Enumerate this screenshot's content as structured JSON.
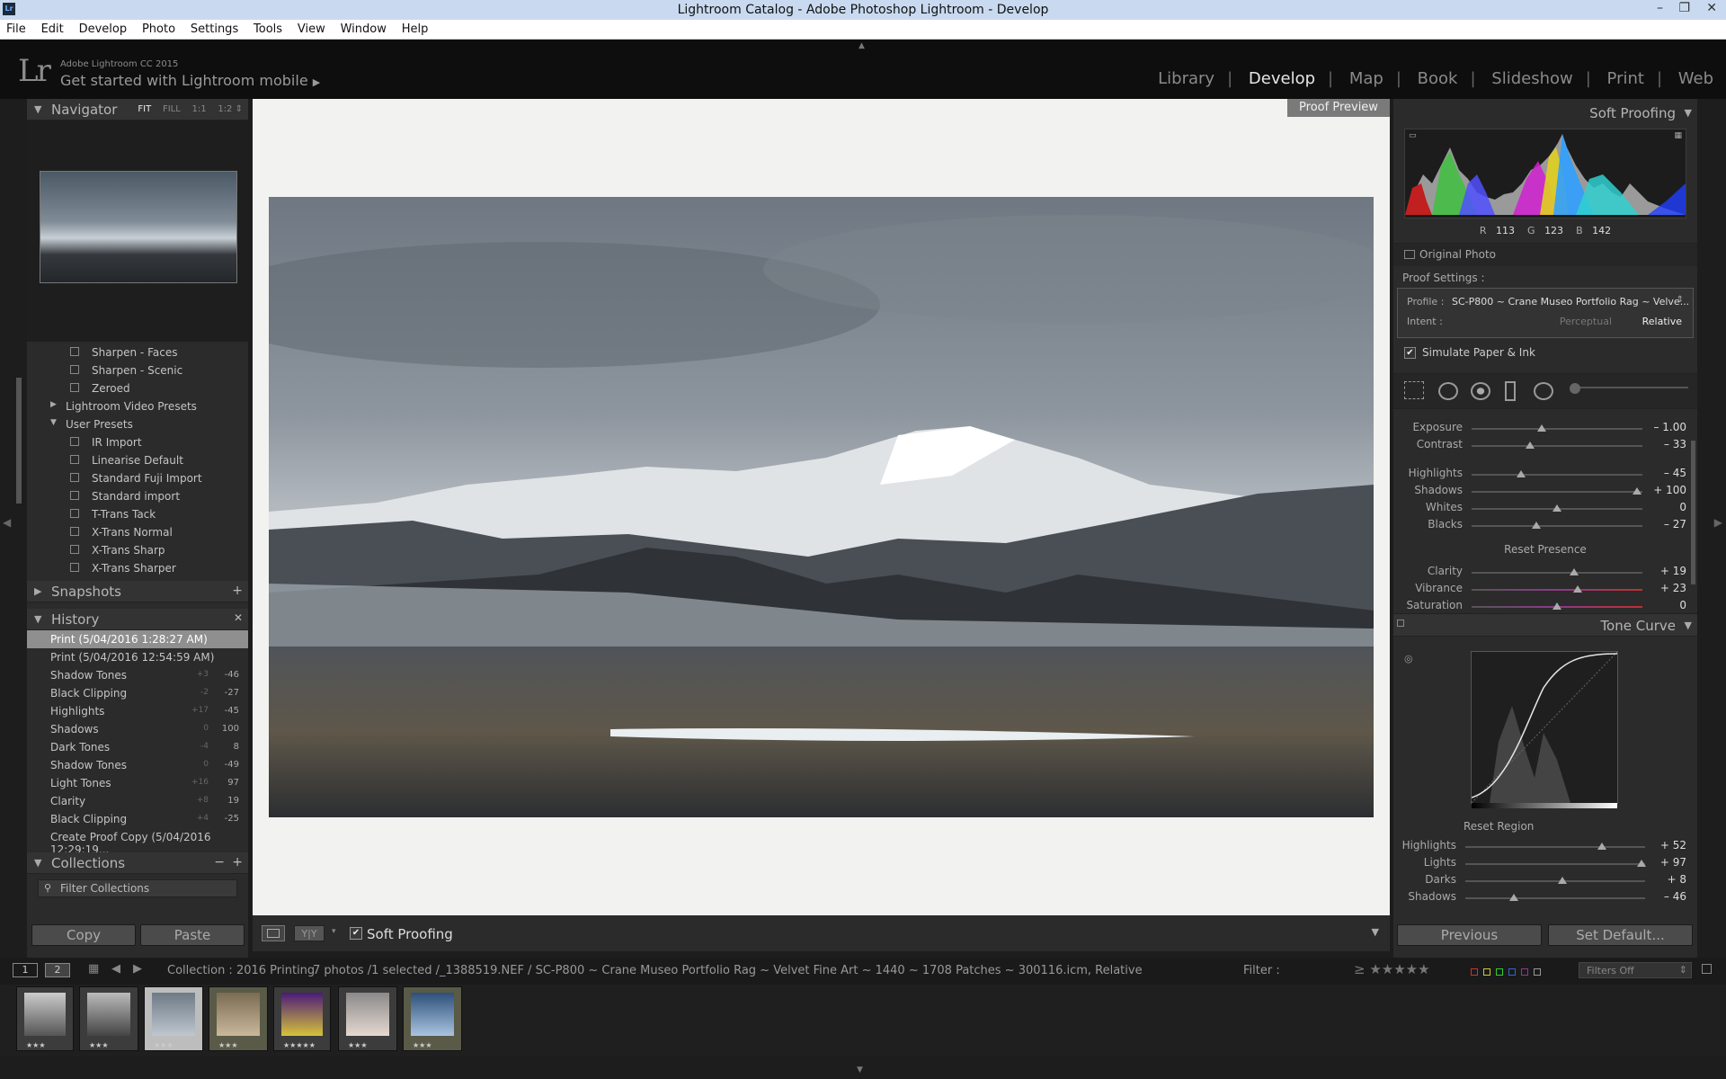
{
  "window": {
    "title": "Lightroom Catalog - Adobe Photoshop Lightroom - Develop",
    "app_icon": "Lr",
    "minimize": "–",
    "restore": "❐",
    "close": "✕"
  },
  "menu": [
    "File",
    "Edit",
    "Develop",
    "Photo",
    "Settings",
    "Tools",
    "View",
    "Window",
    "Help"
  ],
  "identity": {
    "logo": "Lr",
    "version": "Adobe Lightroom CC 2015",
    "mobile": "Get started with Lightroom mobile",
    "mobile_arrow": "▶"
  },
  "modules": [
    "Library",
    "Develop",
    "Map",
    "Book",
    "Slideshow",
    "Print",
    "Web"
  ],
  "modules_active": "Develop",
  "navigator": {
    "title": "Navigator",
    "fit": "FIT",
    "fill": "FILL",
    "one": "1:1",
    "ratio": "1:2",
    "ratio_arrow": "⇕"
  },
  "presets": [
    {
      "label": "Sharpen - Faces",
      "type": "item"
    },
    {
      "label": "Sharpen - Scenic",
      "type": "item"
    },
    {
      "label": "Zeroed",
      "type": "item"
    },
    {
      "label": "Lightroom Video Presets",
      "type": "folder",
      "tri": "▶"
    },
    {
      "label": "User Presets",
      "type": "folder",
      "tri": "▼"
    },
    {
      "label": "IR Import",
      "type": "item"
    },
    {
      "label": "Linearise Default",
      "type": "item"
    },
    {
      "label": "Standard Fuji Import",
      "type": "item"
    },
    {
      "label": "Standard import",
      "type": "item"
    },
    {
      "label": "T-Trans Tack",
      "type": "item"
    },
    {
      "label": "X-Trans Normal",
      "type": "item"
    },
    {
      "label": "X-Trans Sharp",
      "type": "item"
    },
    {
      "label": "X-Trans Sharper",
      "type": "item"
    }
  ],
  "snapshots": {
    "title": "Snapshots",
    "add": "+"
  },
  "history": {
    "title": "History",
    "clear": "✕",
    "items": [
      {
        "label": "Print (5/04/2016 1:28:27 AM)",
        "a": "",
        "b": ""
      },
      {
        "label": "Print (5/04/2016 12:54:59 AM)",
        "a": "",
        "b": ""
      },
      {
        "label": "Shadow Tones",
        "a": "+3",
        "b": "-46"
      },
      {
        "label": "Black Clipping",
        "a": "-2",
        "b": "-27"
      },
      {
        "label": "Highlights",
        "a": "+17",
        "b": "-45"
      },
      {
        "label": "Shadows",
        "a": "0",
        "b": "100"
      },
      {
        "label": "Dark Tones",
        "a": "-4",
        "b": "8"
      },
      {
        "label": "Shadow Tones",
        "a": "0",
        "b": "-49"
      },
      {
        "label": "Light Tones",
        "a": "+16",
        "b": "97"
      },
      {
        "label": "Clarity",
        "a": "+8",
        "b": "19"
      },
      {
        "label": "Black Clipping",
        "a": "+4",
        "b": "-25"
      },
      {
        "label": "Create Proof Copy (5/04/2016 12:29:19...",
        "a": "",
        "b": ""
      }
    ]
  },
  "collections": {
    "title": "Collections",
    "minus": "−",
    "plus": "+",
    "filter": "Filter Collections"
  },
  "left_buttons": {
    "copy": "Copy",
    "paste": "Paste"
  },
  "center": {
    "proof_preview": "Proof Preview"
  },
  "toolbar": {
    "soft_proofing": "Soft Proofing",
    "check": "✔",
    "yy": "Y|Y"
  },
  "right": {
    "soft_proofing": "Soft Proofing",
    "rgb": {
      "r_label": "R",
      "r": "113",
      "g_label": "G",
      "g": "123",
      "b_label": "B",
      "b": "142"
    },
    "original_photo": "Original Photo",
    "proof_settings": "Proof Settings :",
    "profile_label": "Profile :",
    "profile": "SC-P800 ~ Crane Museo Portfolio Rag ~ Velve...",
    "intent_label": "Intent :",
    "perceptual": "Perceptual",
    "relative": "Relative",
    "simulate": "Simulate Paper & Ink",
    "basic": [
      {
        "name": "Exposure",
        "value": "– 1.00",
        "pos": 0.41
      },
      {
        "name": "Contrast",
        "value": "– 33",
        "pos": 0.34
      },
      {
        "name": "Highlights",
        "value": "– 45",
        "pos": 0.29
      },
      {
        "name": "Shadows",
        "value": "+ 100",
        "pos": 0.97
      },
      {
        "name": "Whites",
        "value": "0",
        "pos": 0.5
      },
      {
        "name": "Blacks",
        "value": "– 27",
        "pos": 0.38
      }
    ],
    "reset_presence": "Reset Presence",
    "presence": [
      {
        "name": "Clarity",
        "value": "+ 19",
        "pos": 0.6
      },
      {
        "name": "Vibrance",
        "value": "+ 23",
        "pos": 0.62
      },
      {
        "name": "Saturation",
        "value": "0",
        "pos": 0.5
      }
    ],
    "tone_curve": "Tone Curve",
    "reset_region": "Reset Region",
    "region": [
      {
        "name": "Highlights",
        "value": "+ 52",
        "pos": 0.76
      },
      {
        "name": "Lights",
        "value": "+ 97",
        "pos": 0.98
      },
      {
        "name": "Darks",
        "value": "+ 8",
        "pos": 0.54
      },
      {
        "name": "Shadows",
        "value": "– 46",
        "pos": 0.27
      }
    ],
    "previous": "Previous",
    "set_default": "Set Default..."
  },
  "filmbar": {
    "page1": "1",
    "page2": "2",
    "collection": "Collection : 2016 Printing",
    "info": "7 photos /1 selected /_1388519.NEF / SC-P800 ~ Crane Museo Portfolio Rag ~ Velvet Fine Art ~ 1440 ~ 1708 Patches ~ 300116.icm, Relative",
    "filter_label": "Filter :",
    "filters_off": "Filters Off",
    "stars": "≥ ★★★★★"
  },
  "thumbs": [
    {
      "stars": "★★★",
      "colors": [
        "#ccc",
        "#555"
      ]
    },
    {
      "stars": "★★★",
      "colors": [
        "#bbb",
        "#444"
      ]
    },
    {
      "stars": "★★★",
      "colors": [
        "#6e7a86",
        "#bfc7cf"
      ]
    },
    {
      "stars": "★★★",
      "colors": [
        "#7b6b52",
        "#c9b89a"
      ]
    },
    {
      "stars": "★★★★★",
      "colors": [
        "#4a1a7a",
        "#d6c23a"
      ]
    },
    {
      "stars": "★★★",
      "colors": [
        "#8a8a8a",
        "#e5d8d0"
      ]
    },
    {
      "stars": "★★★",
      "colors": [
        "#2d4f7a",
        "#a9c4df"
      ]
    }
  ]
}
